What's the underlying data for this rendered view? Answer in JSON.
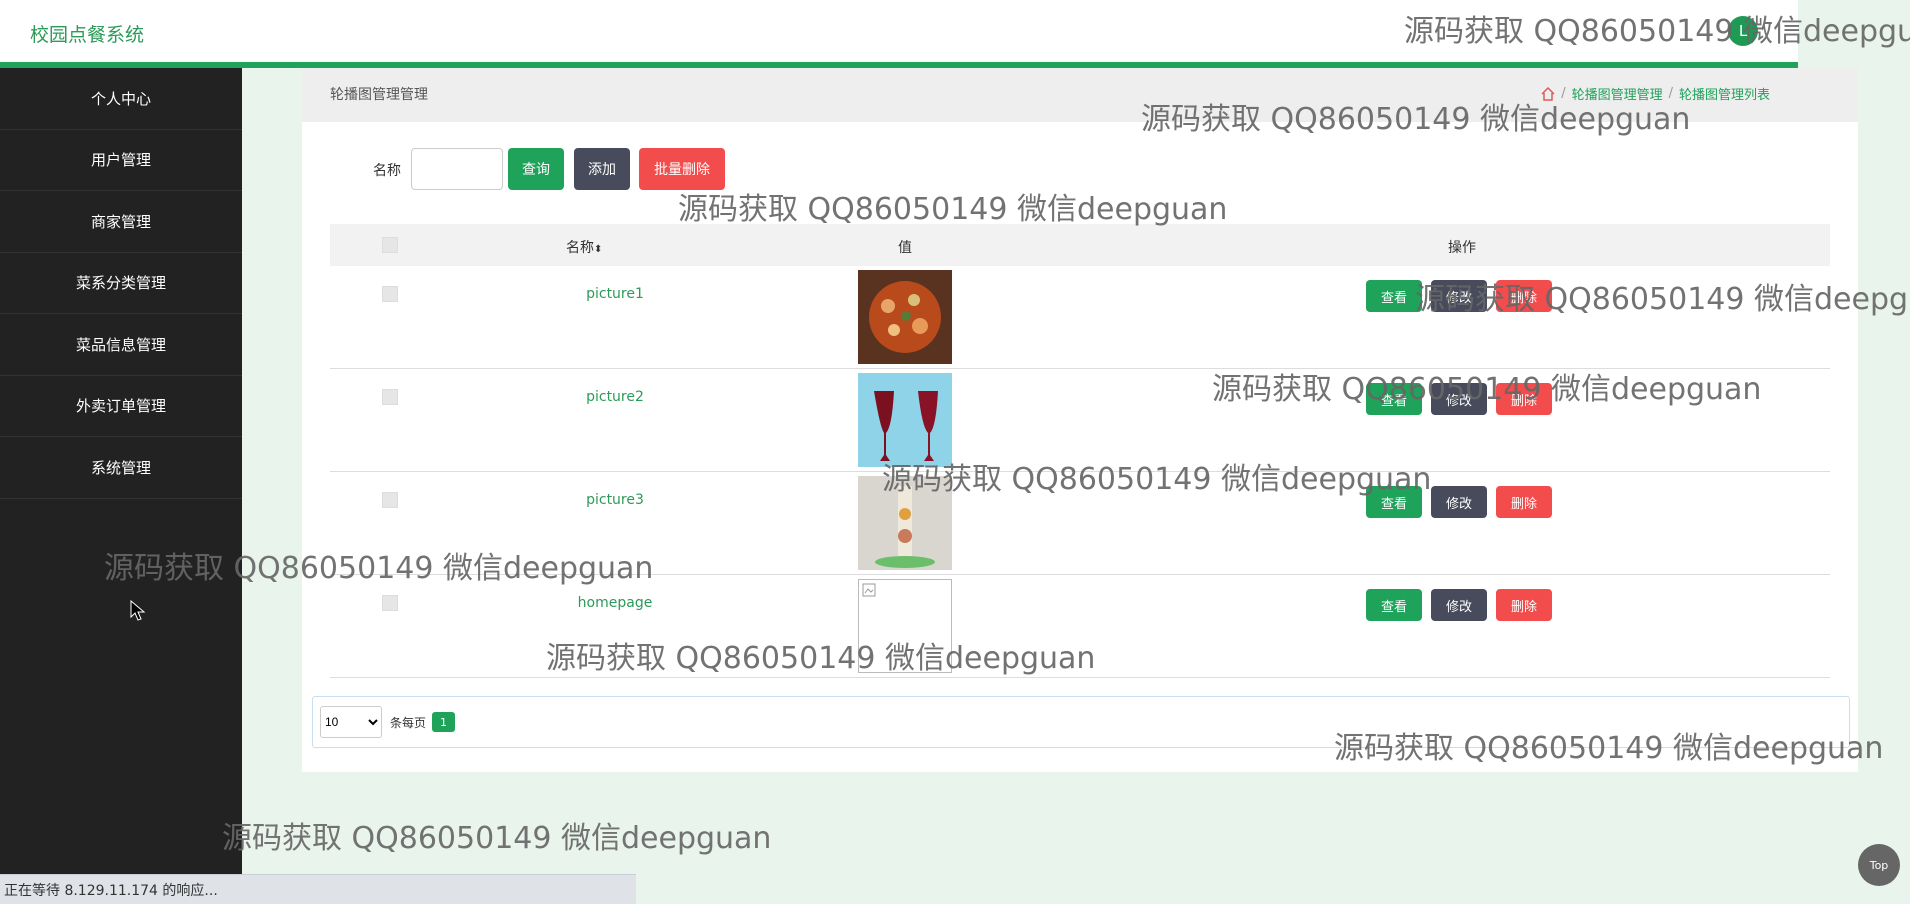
{
  "app": {
    "title": "校园点餐系统",
    "avatar_text": "L",
    "primary_color": "#1fa25a",
    "sidebar_color": "#222222"
  },
  "sidebar": {
    "items": [
      {
        "label": "个人中心"
      },
      {
        "label": "用户管理"
      },
      {
        "label": "商家管理"
      },
      {
        "label": "菜系分类管理"
      },
      {
        "label": "菜品信息管理"
      },
      {
        "label": "外卖订单管理"
      },
      {
        "label": "系统管理"
      }
    ]
  },
  "breadcrumb": {
    "section_title": "轮播图管理管理",
    "items": [
      "轮播图管理管理",
      "轮播图管理列表"
    ],
    "separator": "/"
  },
  "search": {
    "name_label": "名称",
    "name_value": "",
    "search_label": "查询",
    "add_label": "添加",
    "bulk_delete_label": "批量删除"
  },
  "table": {
    "headers": {
      "name": "名称",
      "value": "值",
      "actions": "操作"
    },
    "rows": [
      {
        "name": "picture1",
        "image": "food-dish-1"
      },
      {
        "name": "picture2",
        "image": "wine-glasses"
      },
      {
        "name": "picture3",
        "image": "dessert-plate"
      },
      {
        "name": "homepage",
        "image": "broken-image"
      }
    ],
    "action_labels": {
      "view": "查看",
      "edit": "修改",
      "delete": "删除"
    }
  },
  "pagination": {
    "page_size_options": [
      "10"
    ],
    "page_size": "10",
    "per_page_label": "条每页",
    "current_page": "1"
  },
  "watermark": "源码获取 QQ86050149 微信deepguan",
  "statusbar": {
    "text": "正在等待 8.129.11.174 的响应..."
  },
  "top_button": {
    "label": "Top"
  }
}
